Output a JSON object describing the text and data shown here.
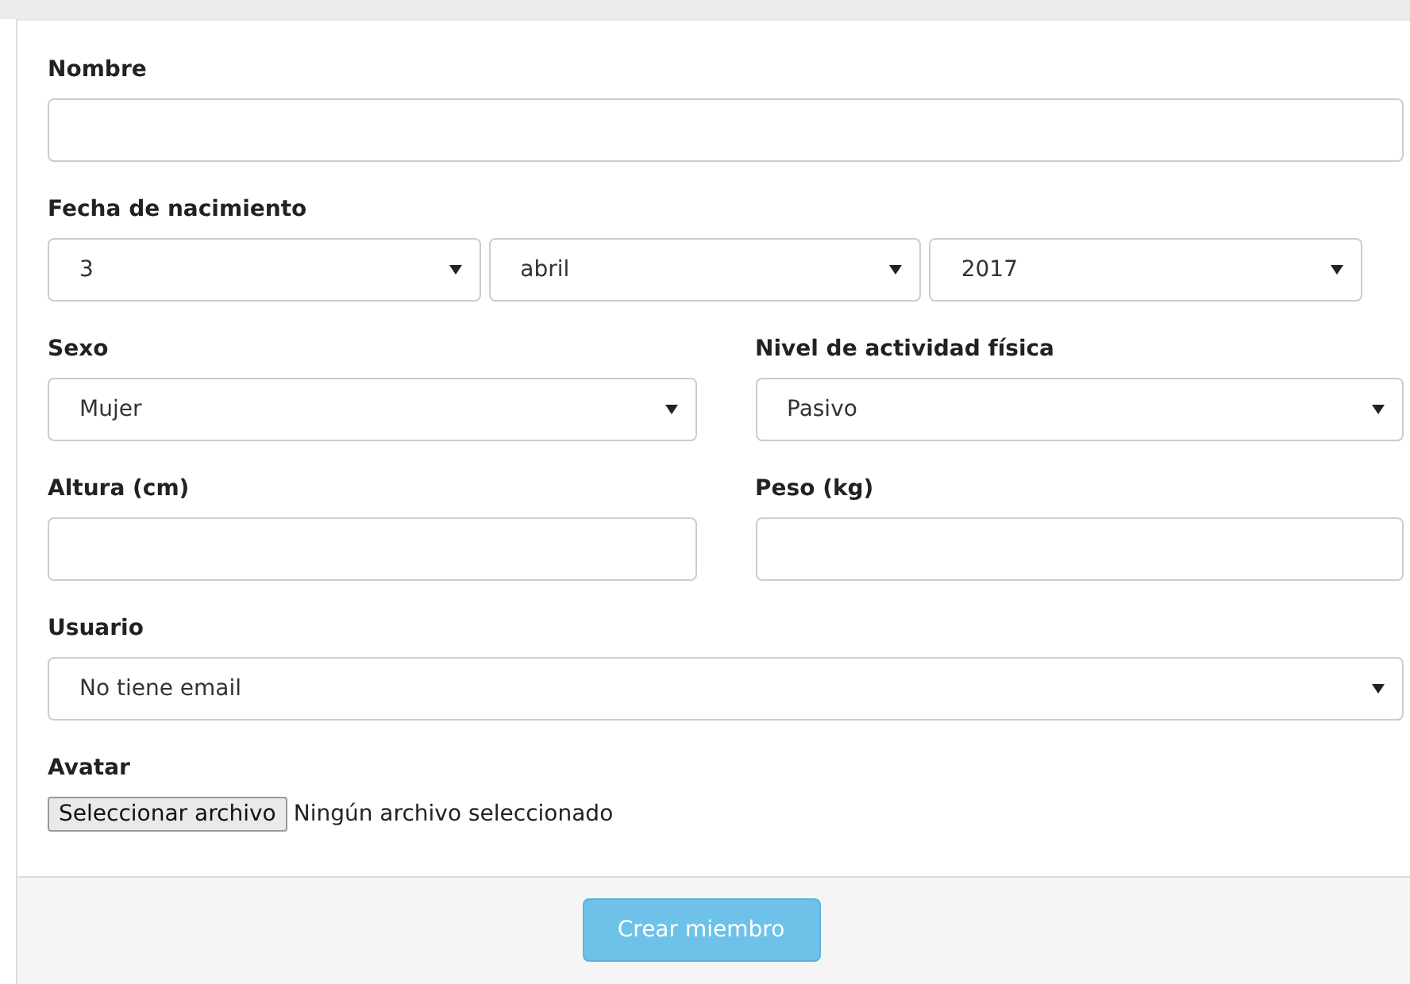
{
  "form": {
    "rows": [
      {
        "fields": [
          {
            "kind": "text",
            "label": "Nombre"
          }
        ]
      },
      {
        "fields": [
          {
            "kind": "date",
            "label": "Fecha de nacimiento",
            "parts": [
              "3",
              "abril",
              "2017"
            ]
          }
        ]
      },
      {
        "fields": [
          {
            "kind": "select",
            "label": "Sexo",
            "value": "Mujer"
          },
          {
            "kind": "select",
            "label": "Nivel de actividad física",
            "value": "Pasivo"
          }
        ]
      },
      {
        "fields": [
          {
            "kind": "text",
            "label": "Altura (cm)"
          },
          {
            "kind": "text",
            "label": "Peso (kg)"
          }
        ]
      },
      {
        "fields": [
          {
            "kind": "select",
            "label": "Usuario",
            "value": "No tiene email"
          }
        ]
      },
      {
        "fields": [
          {
            "kind": "file",
            "label": "Avatar",
            "button": "Seleccionar archivo",
            "status": "Ningún archivo seleccionado"
          }
        ]
      }
    ]
  },
  "submit": {
    "label": "Crear miembro"
  }
}
